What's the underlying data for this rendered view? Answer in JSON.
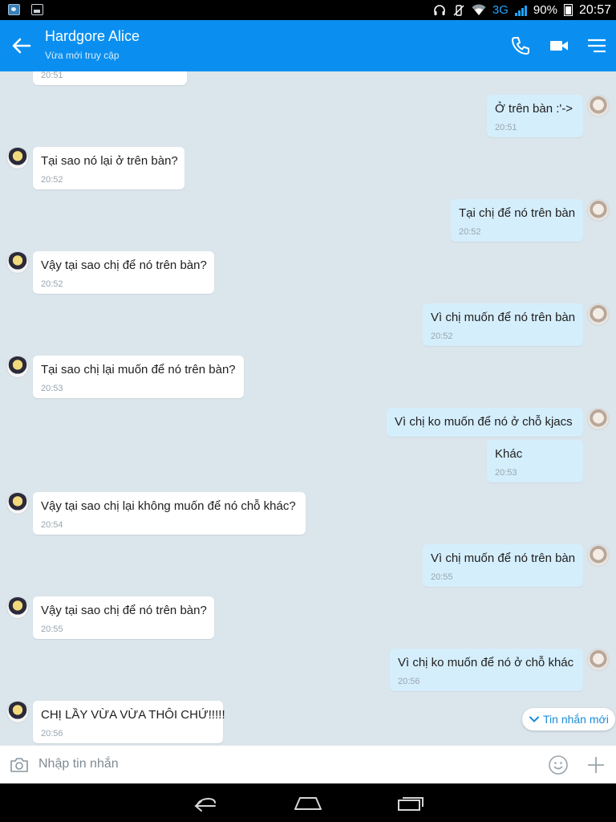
{
  "status_bar": {
    "network": "3G",
    "battery": "90%",
    "time": "20:57"
  },
  "header": {
    "name": "Hardgore Alice",
    "status": "Vừa mới truy cập"
  },
  "messages": [
    {
      "from": "other",
      "text": "",
      "time": "20:51"
    },
    {
      "from": "self",
      "text": "Ở trên bàn :'->",
      "time": "20:51"
    },
    {
      "from": "other",
      "text": "Tại sao nó lại ở trên bàn?",
      "time": "20:52"
    },
    {
      "from": "self",
      "text": "Tại chị để nó trên bàn",
      "time": "20:52"
    },
    {
      "from": "other",
      "text": "Vậy tại sao chị để nó trên bàn?",
      "time": "20:52"
    },
    {
      "from": "self",
      "text": "Vì chị muốn để nó trên bàn",
      "time": "20:52"
    },
    {
      "from": "other",
      "text": "Tại sao chị lại muốn để nó trên bàn?",
      "time": "20:53"
    },
    {
      "from": "self",
      "text": "Vì chị ko muốn để nó ở chỗ kjacs",
      "time": ""
    },
    {
      "from": "self",
      "text": "Khác",
      "time": "20:53"
    },
    {
      "from": "other",
      "text": "Vậy tại sao chị lại không muốn để nó chỗ khác?",
      "time": "20:54"
    },
    {
      "from": "self",
      "text": "Vì chị muốn để nó trên bàn",
      "time": "20:55"
    },
    {
      "from": "other",
      "text": "Vậy tại sao chị để nó trên bàn?",
      "time": "20:55"
    },
    {
      "from": "self",
      "text": "Vì chị ko muốn để nó ở chỗ khác",
      "time": "20:56"
    },
    {
      "from": "other",
      "text": "CHỊ LẦY VỪA VỪA THÔI CHỨ!!!!!",
      "time": "20:56"
    }
  ],
  "new_message_button": {
    "label": "Tin nhắn mới"
  },
  "input": {
    "placeholder": "Nhập tin nhắn"
  },
  "icons": {
    "back": "arrow-left-icon",
    "call": "phone-icon",
    "video": "video-camera-icon",
    "menu": "menu-icon",
    "camera": "camera-icon",
    "emoji": "emoji-icon",
    "plus": "plus-icon",
    "nav_back": "nav-back-icon",
    "nav_home": "nav-home-icon",
    "nav_recent": "nav-recent-icon"
  },
  "colors": {
    "header": "#0a8ff0",
    "chat_bg": "#dbe5ec",
    "incoming": "#ffffff",
    "outgoing": "#d5eefc",
    "accent": "#1a8cd8"
  }
}
